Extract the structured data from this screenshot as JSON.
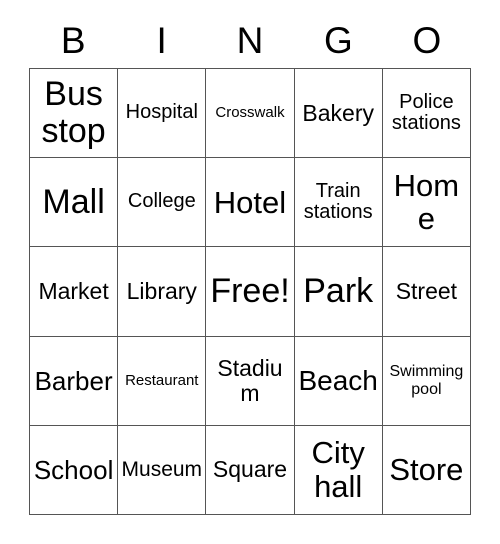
{
  "card": {
    "title": "BINGO",
    "headers": [
      "B",
      "I",
      "N",
      "G",
      "O"
    ],
    "rows": [
      [
        {
          "label": "Bus stop",
          "size": "sz-4xl"
        },
        {
          "label": "Hospital",
          "size": "sz-m"
        },
        {
          "label": "Crosswalk",
          "size": "sz-xs"
        },
        {
          "label": "Bakery",
          "size": "sz-l"
        },
        {
          "label": "Police stations",
          "size": "sz-m"
        }
      ],
      [
        {
          "label": "Mall",
          "size": "sz-4xl"
        },
        {
          "label": "College",
          "size": "sz-m"
        },
        {
          "label": "Hotel",
          "size": "sz-3xl"
        },
        {
          "label": "Train stations",
          "size": "sz-m"
        },
        {
          "label": "Home",
          "size": "sz-3xl"
        }
      ],
      [
        {
          "label": "Market",
          "size": "sz-l"
        },
        {
          "label": "Library",
          "size": "sz-l"
        },
        {
          "label": "Free!",
          "size": "sz-4xl"
        },
        {
          "label": "Park",
          "size": "sz-4xl"
        },
        {
          "label": "Street",
          "size": "sz-l"
        }
      ],
      [
        {
          "label": "Barber",
          "size": "sz-xl"
        },
        {
          "label": "Restaurant",
          "size": "sz-xs"
        },
        {
          "label": "Stadium",
          "size": "sz-l"
        },
        {
          "label": "Beach",
          "size": "sz-xxl"
        },
        {
          "label": "Swimming pool",
          "size": "sz-s"
        }
      ],
      [
        {
          "label": "School",
          "size": "sz-xl"
        },
        {
          "label": "Museum",
          "size": "sz-ml"
        },
        {
          "label": "Square",
          "size": "sz-l"
        },
        {
          "label": "City hall",
          "size": "sz-3xl"
        },
        {
          "label": "Store",
          "size": "sz-3xl"
        }
      ]
    ],
    "colors": {
      "background": "#ffffff",
      "text": "#000000",
      "border": "#555555"
    }
  }
}
